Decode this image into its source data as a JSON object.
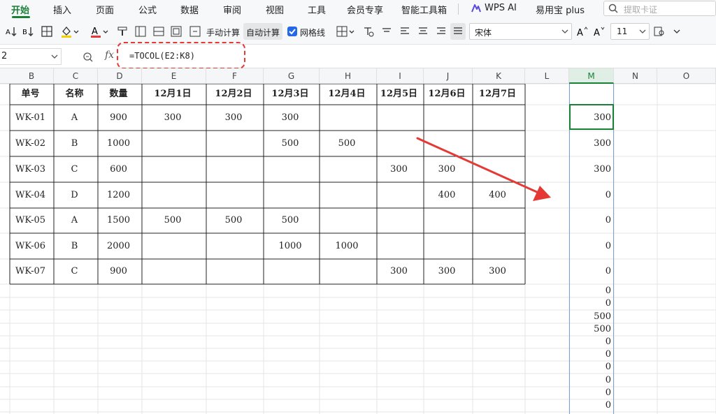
{
  "menu": {
    "items": [
      "开始",
      "插入",
      "页面",
      "公式",
      "数据",
      "审阅",
      "视图",
      "工具",
      "会员专享",
      "智能工具箱",
      "WPS AI",
      "易用宝 plus"
    ],
    "search_placeholder": "提取卡证"
  },
  "toolbar": {
    "manual_calc": "手动计算",
    "auto_calc": "自动计算",
    "gridlines": "网格线",
    "font_name": "宋体",
    "font_size": "11"
  },
  "formula_bar": {
    "name_box": "2",
    "fx": "fx",
    "formula": "=TOCOL(E2:K8)"
  },
  "columns": [
    "B",
    "C",
    "D",
    "E",
    "F",
    "G",
    "H",
    "I",
    "J",
    "K",
    "L",
    "M",
    "N",
    "O"
  ],
  "table": {
    "headers": [
      "单号",
      "名称",
      "数量",
      "12月1日",
      "12月2日",
      "12月3日",
      "12月4日",
      "12月5日",
      "12月6日",
      "12月7日"
    ],
    "rows": [
      [
        "WK-01",
        "A",
        "900",
        "300",
        "300",
        "300",
        "",
        "",
        "",
        ""
      ],
      [
        "WK-02",
        "B",
        "1000",
        "",
        "",
        "500",
        "500",
        "",
        "",
        ""
      ],
      [
        "WK-03",
        "C",
        "600",
        "",
        "",
        "",
        "",
        "300",
        "300",
        ""
      ],
      [
        "WK-04",
        "D",
        "1200",
        "",
        "",
        "",
        "",
        "",
        "400",
        "400"
      ],
      [
        "WK-05",
        "A",
        "1500",
        "500",
        "500",
        "500",
        "",
        "",
        "",
        ""
      ],
      [
        "WK-06",
        "B",
        "2000",
        "",
        "",
        "1000",
        "1000",
        "",
        "",
        ""
      ],
      [
        "WK-07",
        "C",
        "900",
        "",
        "",
        "",
        "",
        "300",
        "300",
        "300"
      ]
    ]
  },
  "column_m_values": [
    "300",
    "300",
    "300",
    "0",
    "0",
    "0",
    "0",
    "0",
    "0",
    "500",
    "500",
    "0",
    "0",
    "0",
    "0",
    "0",
    "0"
  ],
  "colors": {
    "accent": "#1a7f37",
    "annotation": "#e53935",
    "selection": "#7aa0d8"
  }
}
